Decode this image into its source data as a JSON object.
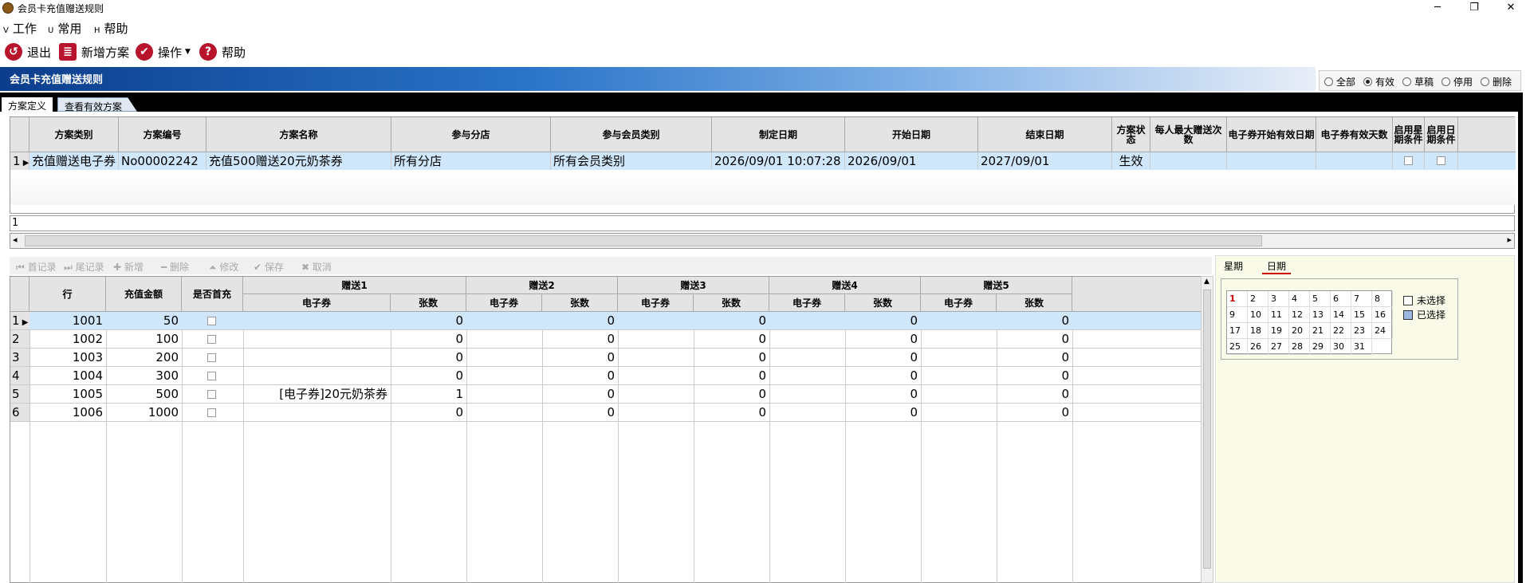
{
  "window": {
    "title": "会员卡充值赠送规则",
    "minimize": "─",
    "restore": "❐",
    "close": "✕"
  },
  "menu": [
    {
      "key": "V",
      "label": "工作"
    },
    {
      "key": "U",
      "label": "常用"
    },
    {
      "key": "H",
      "label": "帮助"
    }
  ],
  "toolbar": {
    "exit": "退出",
    "new_plan": "新增方案",
    "operate": "操作",
    "help": "帮助"
  },
  "banner": {
    "title": "会员卡充值赠送规则"
  },
  "filter": {
    "all": "全部",
    "valid": "有效",
    "draft": "草稿",
    "disabled": "停用",
    "deleted": "删除",
    "selected": "valid"
  },
  "tabs": {
    "plan_def": "方案定义",
    "view_valid": "查看有效方案"
  },
  "top_grid": {
    "headers": [
      "方案类别",
      "方案编号",
      "方案名称",
      "参与分店",
      "参与会员类别",
      "制定日期",
      "开始日期",
      "结束日期",
      "方案状态",
      "每人最大赠送次数",
      "电子券开始有效日期",
      "电子券有效天数",
      "启用星期条件",
      "启用日期条件"
    ],
    "row": {
      "num": "1",
      "category": "充值赠送电子券",
      "code": "No00002242",
      "name": "充值500赠送20元奶茶券",
      "stores": "所有分店",
      "member_types": "所有会员类别",
      "created": "2026/09/01 10:07:28",
      "start": "2026/09/01",
      "end": "2027/09/01",
      "status": "生效"
    },
    "record_indicator": "1"
  },
  "nav": {
    "first": "首记录",
    "last": "尾记录",
    "add": "新增",
    "delete": "删除",
    "edit": "修改",
    "save": "保存",
    "cancel": "取消"
  },
  "bottom_grid": {
    "headers": {
      "row": "行",
      "amount": "充值金额",
      "first": "是否首充",
      "gifts": [
        "赠送1",
        "赠送2",
        "赠送3",
        "赠送4",
        "赠送5"
      ],
      "coupon": "电子券",
      "count": "张数"
    },
    "rows": [
      {
        "n": "1",
        "row": "1001",
        "amount": "50",
        "c1": "",
        "q1": "0",
        "q2": "0",
        "q3": "0",
        "q4": "0",
        "q5": "0"
      },
      {
        "n": "2",
        "row": "1002",
        "amount": "100",
        "c1": "",
        "q1": "0",
        "q2": "0",
        "q3": "0",
        "q4": "0",
        "q5": "0"
      },
      {
        "n": "3",
        "row": "1003",
        "amount": "200",
        "c1": "",
        "q1": "0",
        "q2": "0",
        "q3": "0",
        "q4": "0",
        "q5": "0"
      },
      {
        "n": "4",
        "row": "1004",
        "amount": "300",
        "c1": "",
        "q1": "0",
        "q2": "0",
        "q3": "0",
        "q4": "0",
        "q5": "0"
      },
      {
        "n": "5",
        "row": "1005",
        "amount": "500",
        "c1": "[电子券]20元奶茶券",
        "q1": "1",
        "q2": "0",
        "q3": "0",
        "q4": "0",
        "q5": "0"
      },
      {
        "n": "6",
        "row": "1006",
        "amount": "1000",
        "c1": "",
        "q1": "0",
        "q2": "0",
        "q3": "0",
        "q4": "0",
        "q5": "0"
      }
    ]
  },
  "right_panel": {
    "tab_week": "星期",
    "tab_date": "日期",
    "days": [
      "1",
      "2",
      "3",
      "4",
      "5",
      "6",
      "7",
      "8",
      "9",
      "10",
      "11",
      "12",
      "13",
      "14",
      "15",
      "16",
      "17",
      "18",
      "19",
      "20",
      "21",
      "22",
      "23",
      "24",
      "25",
      "26",
      "27",
      "28",
      "29",
      "30",
      "31"
    ],
    "unselected": "未选择",
    "selected": "已选择"
  }
}
